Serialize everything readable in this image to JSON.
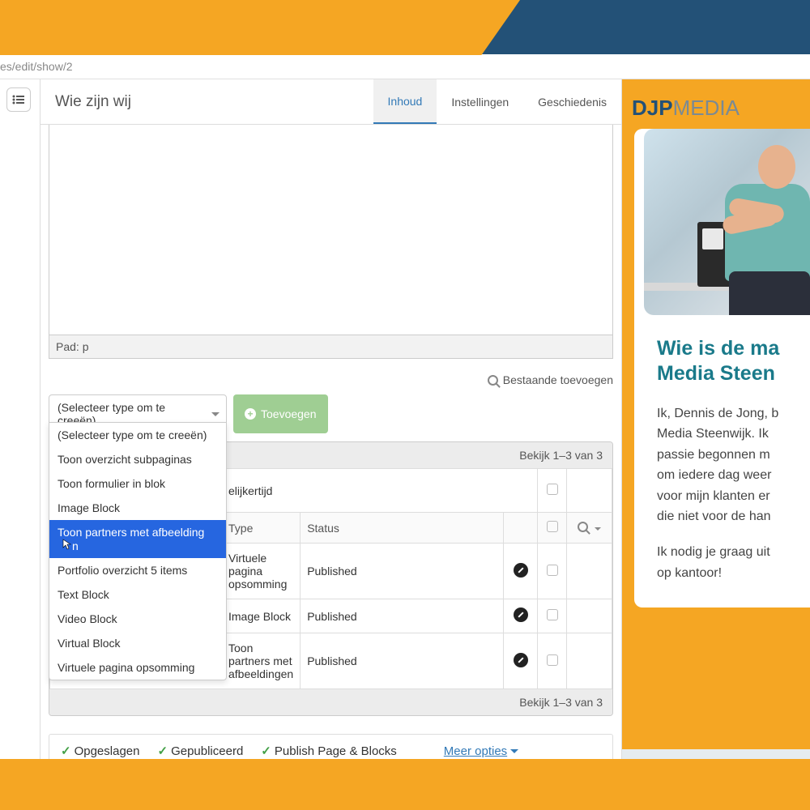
{
  "url_path": "es/edit/show/2",
  "page_title": "Wie zijn wij",
  "tabs": {
    "content": "Inhoud",
    "settings": "Instellingen",
    "history": "Geschiedenis"
  },
  "rte_path": "Pad: p",
  "existing_link": "Bestaande toevoegen",
  "select_placeholder": "(Selecteer type om te creeën)",
  "add_button": "Toevoegen",
  "dropdown": [
    "(Selecteer type om te creeën)",
    "Toon overzicht subpaginas",
    "Toon formulier in blok",
    "Image Block",
    "Toon partners met afbeeldingen",
    "Portfolio overzicht 5 items",
    "Text Block",
    "Video Block",
    "Virtual Block",
    "Virtuele pagina opsomming"
  ],
  "dropdown_selected_index": 4,
  "grid": {
    "pager": "Bekijk 1–3 van 3",
    "section_title_suffix": "elijkertijd",
    "headers": {
      "type": "Type",
      "status": "Status"
    },
    "rows": [
      {
        "type": "Virtuele pagina opsomming",
        "status": "Published"
      },
      {
        "type": "Image Block",
        "status": "Published"
      },
      {
        "type": "Toon partners met afbeeldingen",
        "status": "Published"
      }
    ]
  },
  "status": {
    "saved": "Opgeslagen",
    "published": "Gepubliceerd",
    "publish_blocks": "Publish Page & Blocks",
    "more": "Meer opties"
  },
  "preview": {
    "logo_a": "DJP",
    "logo_b": "MEDIA",
    "heading_l1": "Wie is de ma",
    "heading_l2": "Media Steen",
    "para1": [
      "Ik, Dennis de Jong, b",
      "Media Steenwijk. Ik",
      "passie begonnen m",
      "om iedere dag weer",
      "voor mijn klanten er",
      "die niet voor de han"
    ],
    "para2": [
      "Ik nodig je graag uit",
      "op kantoor!"
    ]
  },
  "collapse_glyph": "«"
}
